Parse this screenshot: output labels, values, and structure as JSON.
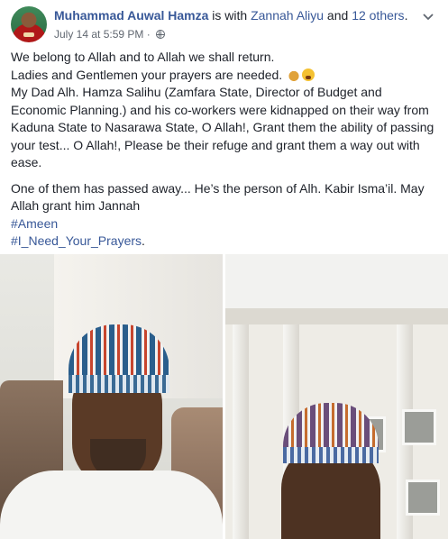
{
  "header": {
    "author": "Muhammad Auwal Hamza",
    "with_text": " is with ",
    "tagged": "Zannah Aliyu",
    "and_text": " and ",
    "others": "12 others",
    "period": ".",
    "timestamp": "July 14 at 5:59 PM",
    "separator": " · ",
    "privacy_icon": "globe-icon",
    "menu_icon": "chevron-down-icon"
  },
  "post": {
    "lines": [
      "We belong to Allah and to Allah we shall return.",
      "Ladies and Gentlemen your prayers are needed.",
      "My Dad Alh. Hamza Salihu (Zamfara State, Director of Budget and Economic Planning.) and his co-workers were kidnapped on their way from Kaduna State to Nasarawa State, O Allah!, Grant them the ability of passing your test... O Allah!, Please be their refuge and grant them a way out with ease.",
      "One of them has passed away... He’s the person of Alh. Kabir Isma’il. May Allah grant him Jannah"
    ],
    "emojis": [
      "folded-hands-icon",
      "crying-face-icon"
    ],
    "hashtags": [
      "#Ameen",
      "#I_Need_Your_Prayers"
    ],
    "trailing_period": "."
  },
  "colors": {
    "link": "#385898",
    "text": "#1d2129",
    "meta": "#606770"
  }
}
